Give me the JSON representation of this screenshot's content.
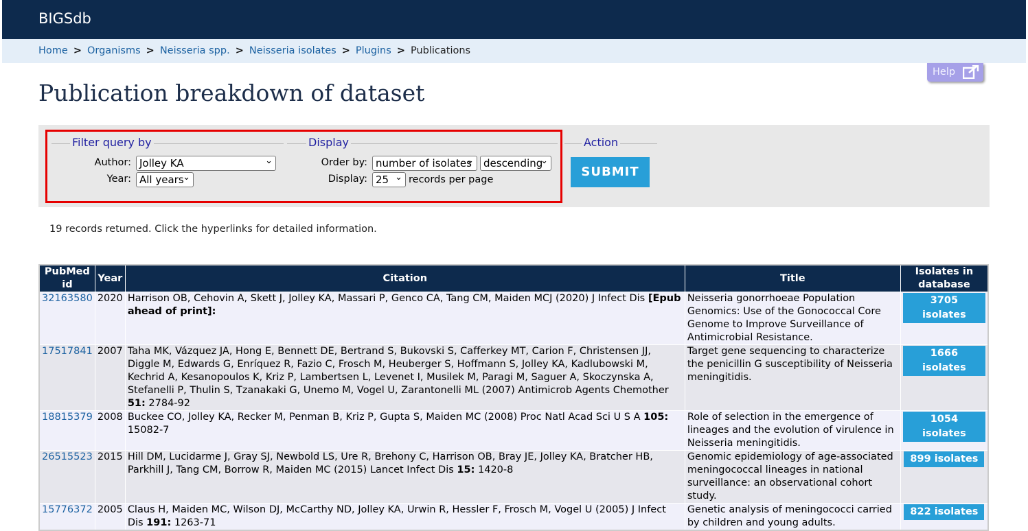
{
  "brand": "BIGSdb",
  "breadcrumbs": [
    "Home",
    "Organisms",
    "Neisseria spp.",
    "Neisseria isolates",
    "Plugins"
  ],
  "breadcrumb_current": "Publications",
  "breadcrumb_separator": ">",
  "help_label": "Help",
  "page_title": "Publication breakdown of dataset",
  "filter": {
    "legend": "Filter query by",
    "author_label": "Author:",
    "author_value": "Jolley KA",
    "year_label": "Year:",
    "year_value": "All years"
  },
  "display": {
    "legend": "Display",
    "order_label": "Order by:",
    "order_value": "number of isolates",
    "direction_value": "descending",
    "display_label": "Display:",
    "display_value": "25",
    "per_page_text": "records per page"
  },
  "action": {
    "legend": "Action",
    "submit_label": "SUBMIT"
  },
  "summary": "19 records returned. Click the hyperlinks for detailed information.",
  "table": {
    "headers": [
      "PubMed id",
      "Year",
      "Citation",
      "Title",
      "Isolates in database"
    ],
    "rows": [
      {
        "pmid": "32163580",
        "year": "2020",
        "citation": "Harrison OB, Cehovin A, Skett J, Jolley KA, Massari P, Genco CA, Tang CM, Maiden MCJ (2020) J Infect Dis ",
        "cit_bold": "[Epub ahead of print]:",
        "cit_tail": "",
        "title": "Neisseria gonorrhoeae Population Genomics: Use of the Gonococcal Core Genome to Improve Surveillance of Antimicrobial Resistance.",
        "isolates": "3705 isolates"
      },
      {
        "pmid": "17517841",
        "year": "2007",
        "citation": "Taha MK, Vázquez JA, Hong E, Bennett DE, Bertrand S, Bukovski S, Cafferkey MT, Carion F, Christensen JJ, Diggle M, Edwards G, Enríquez R, Fazio C, Frosch M, Heuberger S, Hoffmann S, Jolley KA, Kadlubowski M, Kechrid A, Kesanopoulos K, Kriz P, Lambertsen L, Levenet I, Musilek M, Paragi M, Saguer A, Skoczynska A, Stefanelli P, Thulin S, Tzanakaki G, Unemo M, Vogel U, Zarantonelli ML (2007) Antimicrob Agents Chemother ",
        "cit_bold": "51:",
        "cit_tail": " 2784-92",
        "title": "Target gene sequencing to characterize the penicillin G susceptibility of Neisseria meningitidis.",
        "isolates": "1666 isolates"
      },
      {
        "pmid": "18815379",
        "year": "2008",
        "citation": "Buckee CO, Jolley KA, Recker M, Penman B, Kriz P, Gupta S, Maiden MC (2008) Proc Natl Acad Sci U S A ",
        "cit_bold": "105:",
        "cit_tail": " 15082-7",
        "title": "Role of selection in the emergence of lineages and the evolution of virulence in Neisseria meningitidis.",
        "isolates": "1054 isolates"
      },
      {
        "pmid": "26515523",
        "year": "2015",
        "citation": "Hill DM, Lucidarme J, Gray SJ, Newbold LS, Ure R, Brehony C, Harrison OB, Bray JE, Jolley KA, Bratcher HB, Parkhill J, Tang CM, Borrow R, Maiden MC (2015) Lancet Infect Dis ",
        "cit_bold": "15:",
        "cit_tail": " 1420-8",
        "title": "Genomic epidemiology of age-associated meningococcal lineages in national surveillance: an observational cohort study.",
        "isolates": "899 isolates"
      },
      {
        "pmid": "15776372",
        "year": "2005",
        "citation": "Claus H, Maiden MC, Wilson DJ, McCarthy ND, Jolley KA, Urwin R, Hessler F, Frosch M, Vogel U (2005) J Infect Dis ",
        "cit_bold": "191:",
        "cit_tail": " 1263-71",
        "title": "Genetic analysis of meningococci carried by children and young adults.",
        "isolates": "822 isolates"
      }
    ]
  }
}
